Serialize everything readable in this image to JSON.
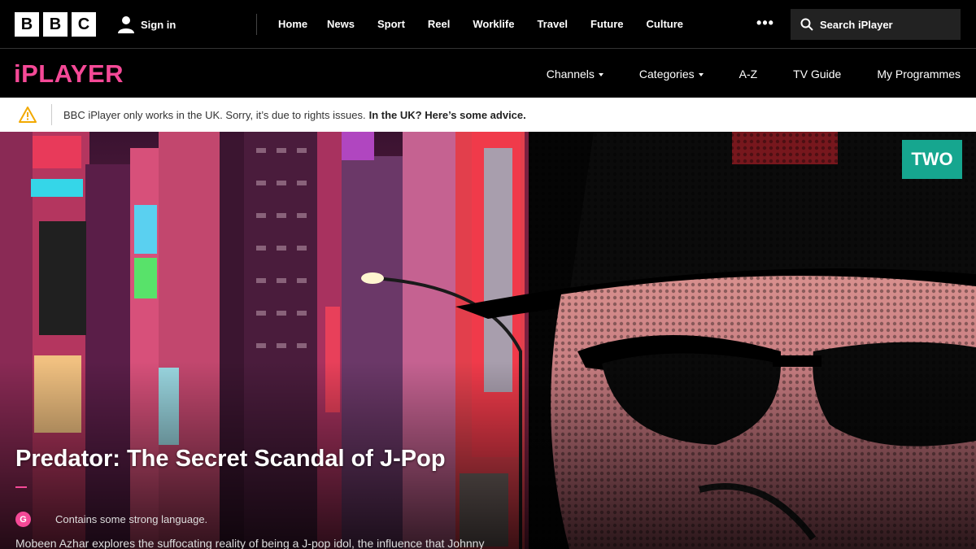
{
  "bbc_logo": [
    "B",
    "B",
    "C"
  ],
  "header": {
    "sign_in": "Sign in",
    "nav": [
      "Home",
      "News",
      "Sport",
      "Reel",
      "Worklife",
      "Travel",
      "Future",
      "Culture"
    ],
    "more": "•••",
    "search_label": "Search iPlayer"
  },
  "iplayer": {
    "logo": "iPLAYER",
    "nav": {
      "channels": "Channels",
      "categories": "Categories",
      "az": "A-Z",
      "tv_guide": "TV Guide",
      "my_programmes": "My Programmes"
    }
  },
  "banner": {
    "message": "BBC iPlayer only works in the UK. Sorry, it’s due to rights issues.",
    "advice_link": "In the UK? Here’s some advice."
  },
  "hero": {
    "channel": "TWO",
    "title": "Predator: The Secret Scandal of J-Pop",
    "guidance_badge": "G",
    "guidance_text": "Contains some strong language.",
    "synopsis": "Mobeen Azhar explores the suffocating reality of being a J-pop idol, the influence that Johnny"
  },
  "colors": {
    "brand_pink": "#f54997",
    "channel_teal": "#16a68f",
    "warning_amber": "#f2a900"
  },
  "icons": [
    "user-icon",
    "search-icon",
    "warning-icon"
  ]
}
